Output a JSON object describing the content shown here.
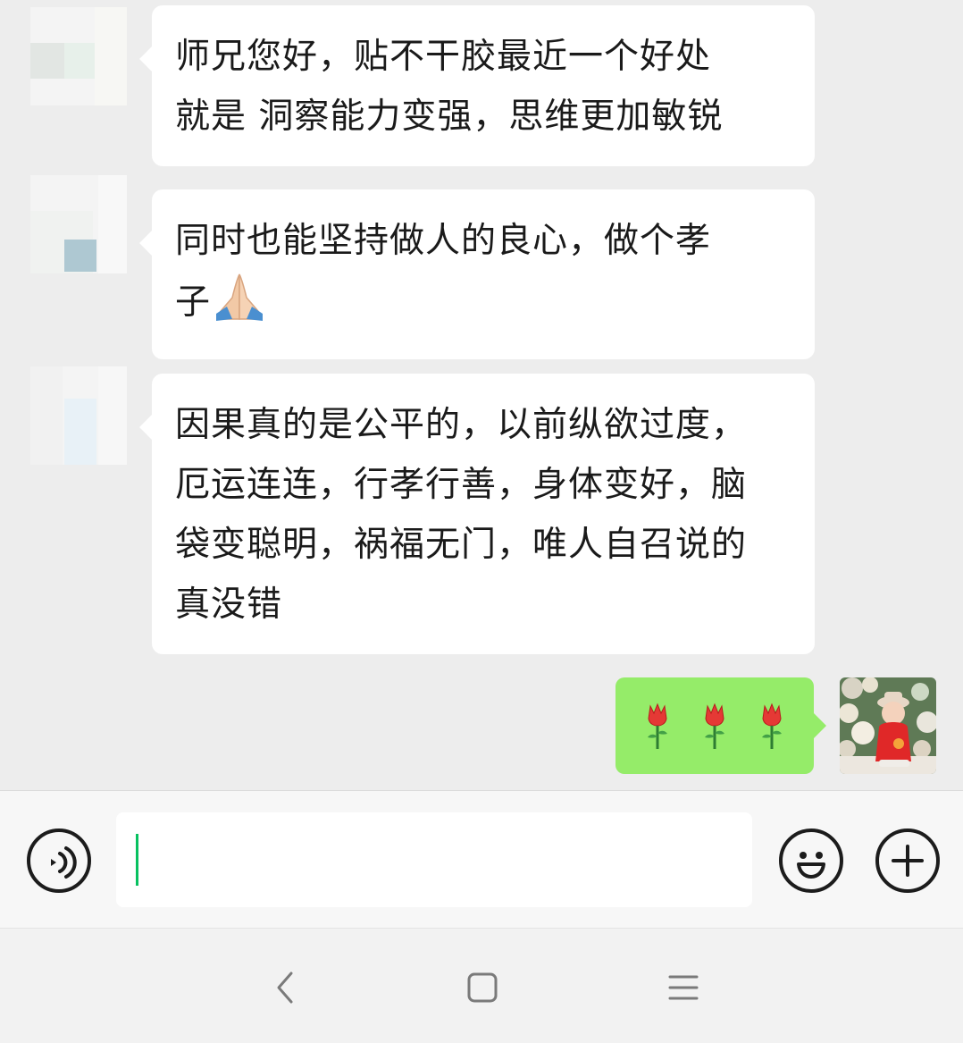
{
  "messages": [
    {
      "direction": "incoming",
      "text": "师兄您好，贴不干胶最近一个好处\n就是 洞察能力变强，思维更加敏锐"
    },
    {
      "direction": "incoming",
      "text": "同时也能坚持做人的良心，做个孝\n子",
      "emoji": "praying-hands-icon"
    },
    {
      "direction": "incoming",
      "text": "因果真的是公平的，以前纵欲过度，\n厄运连连，行孝行善，身体变好，脑\n袋变聪明，祸福无门，唯人自召说的\n真没错"
    },
    {
      "direction": "outgoing",
      "emojis": [
        "rose-icon",
        "rose-icon",
        "rose-icon"
      ]
    }
  ],
  "input": {
    "value": "",
    "placeholder": ""
  },
  "colors": {
    "chat_background": "#ededed",
    "incoming_bubble": "#ffffff",
    "outgoing_bubble": "#95ec69",
    "caret": "#07c160"
  },
  "icons": {
    "voice": "voice-input-icon",
    "emoji": "emoji-icon",
    "more": "plus-icon",
    "nav_back": "back-chevron-icon",
    "nav_home": "home-square-icon",
    "nav_menu": "menu-lines-icon"
  }
}
